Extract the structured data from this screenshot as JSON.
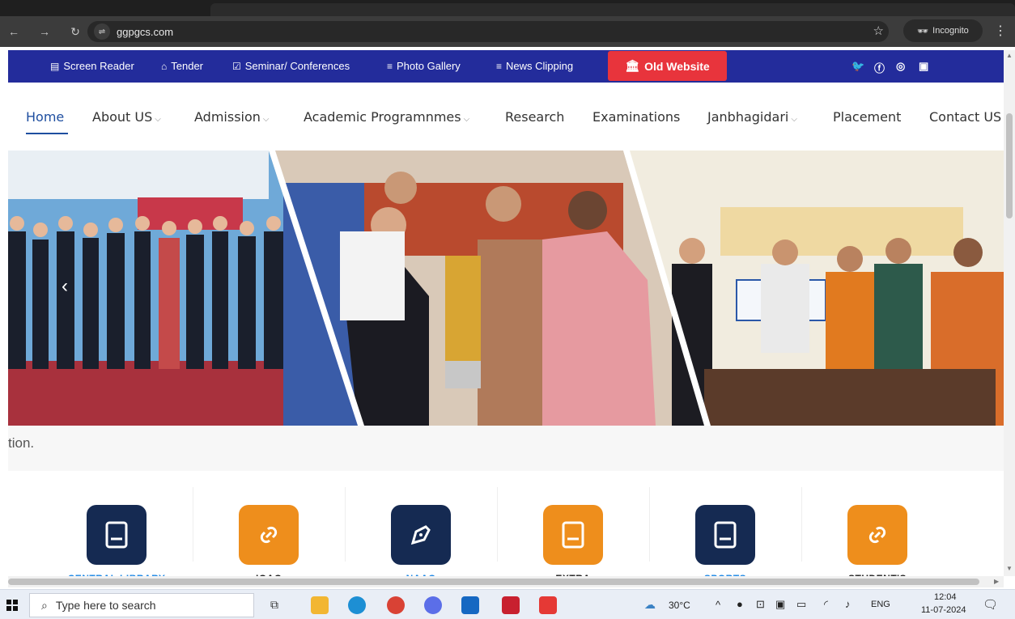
{
  "browser": {
    "url": "ggpgcs.com",
    "incognito_label": "Incognito"
  },
  "topstrip": {
    "items": [
      {
        "icon": "screen-reader-icon",
        "label": "Screen Reader"
      },
      {
        "icon": "tender-icon",
        "label": "Tender"
      },
      {
        "icon": "seminar-icon",
        "label": "Seminar/ Conferences"
      },
      {
        "icon": "gallery-icon",
        "label": "Photo Gallery"
      },
      {
        "icon": "news-icon",
        "label": "News Clipping"
      }
    ],
    "old_website_label": "Old Website",
    "social": [
      "twitter-icon",
      "facebook-icon",
      "instagram-icon",
      "linkedin-icon"
    ],
    "background_color": "#232c9b",
    "old_website_color": "#e8343c"
  },
  "nav": {
    "items": [
      {
        "label": "Home",
        "has_caret": false,
        "active": true
      },
      {
        "label": "About US",
        "has_caret": true
      },
      {
        "label": "Admission",
        "has_caret": true
      },
      {
        "label": "Academic Programnmes",
        "has_caret": true
      },
      {
        "label": "Research",
        "has_caret": false
      },
      {
        "label": "Examinations",
        "has_caret": false
      },
      {
        "label": "Janbhagidari",
        "has_caret": true
      },
      {
        "label": "Placement",
        "has_caret": false
      },
      {
        "label": "Contact US",
        "has_caret": false
      }
    ],
    "active_color": "#1f4fa0"
  },
  "slider": {
    "caption": "tion."
  },
  "cards": [
    {
      "label": "CENTRAL LIBRARY",
      "icon": "book-icon",
      "style": "dark",
      "label_color": "#1e88e5"
    },
    {
      "label": "IQAC",
      "icon": "link-icon",
      "style": "orange",
      "label_color": "#222222"
    },
    {
      "label": "NAAC",
      "icon": "pen-nib-icon",
      "style": "dark",
      "label_color": "#1e88e5"
    },
    {
      "label": "EXTRA",
      "icon": "book-icon",
      "style": "orange",
      "label_color": "#222222"
    },
    {
      "label": "SPORTS",
      "icon": "book-icon",
      "style": "dark",
      "label_color": "#1e88e5"
    },
    {
      "label": "STUDENT'S",
      "icon": "link-icon",
      "style": "orange",
      "label_color": "#222222"
    }
  ],
  "taskbar": {
    "search_placeholder": "Type here to search",
    "weather": "30°C",
    "language": "ENG",
    "time": "12:04",
    "date": "11-07-2024"
  }
}
